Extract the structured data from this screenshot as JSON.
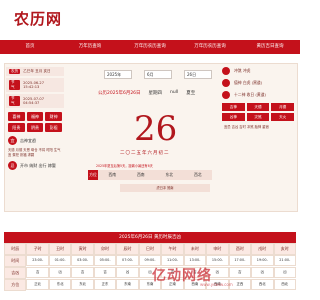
{
  "header": {
    "logo": "农历网"
  },
  "nav": {
    "items": [
      "首页",
      "万年历查询",
      "万年历农历查询",
      "万年历农历查询",
      "黄历吉日查询"
    ]
  },
  "left": {
    "rows": [
      {
        "tag": "农历",
        "val": "乙巳年 丑月 亥日"
      },
      {
        "tag": "节气",
        "val": "2025-06-27 15:42:13"
      },
      {
        "tag": "节气",
        "val": "2025-07-07 04:54:37"
      }
    ],
    "ji_buttons": [
      "喜神",
      "福神",
      "财神",
      "阳贵",
      "阴贵",
      "彭祖"
    ],
    "yi_label": "宜",
    "yi_title": "吉神宜趋",
    "yi_text": "天德 月德 天恩 母仓 不将 时阳 生气 宜 祭祀 祈福 求嗣",
    "ji_label": "忌",
    "ji_text": "开市 纳财 出行 嫁娶"
  },
  "center": {
    "year": "2025年",
    "month": "6月",
    "day": "26日",
    "solar": "公历2025年6月26日",
    "weekday": "星期四",
    "extra": "null",
    "season": "夏至",
    "big_day": "26",
    "lunar": "二〇二五年六月初二",
    "note": "2025年夏至后第5天，距离小暑还有6天",
    "dir_label": "方位",
    "dirs": [
      "西南",
      "西南",
      "东北",
      "西北"
    ],
    "chong": "虎日冲 煞南"
  },
  "right": {
    "rows": [
      {
        "label": "冲煞",
        "val": "冲虎"
      },
      {
        "label": "值神",
        "val": "白虎 (黑道)"
      },
      {
        "label": "十二神",
        "val": "收日 (黄道)"
      }
    ],
    "buttons": [
      "吉神",
      "天德",
      "月德",
      "凶神",
      "灾煞",
      "天火"
    ],
    "bottom": "宜忌 吉凶 吉时 冲煞 胎神 星宿"
  },
  "table": {
    "title": "2025年6月26日 黄历时辰吉凶",
    "headers": [
      "时辰",
      "子时",
      "丑时",
      "寅时",
      "卯时",
      "辰时",
      "巳时",
      "午时",
      "未时",
      "申时",
      "酉时",
      "戌时",
      "亥时"
    ],
    "row1": [
      "时间",
      "23:00-00:59",
      "01:00-02:59",
      "03:00-04:59",
      "05:00-06:59",
      "07:00-08:59",
      "09:00-10:59",
      "11:00-12:59",
      "13:00-14:59",
      "15:00-16:59",
      "17:00-18:59",
      "19:00-20:59",
      "21:00-22:59"
    ],
    "row2": [
      "吉凶",
      "吉",
      "凶",
      "吉",
      "吉",
      "凶",
      "凶",
      "吉",
      "吉",
      "凶",
      "吉",
      "凶",
      "凶"
    ],
    "row3": [
      "方位",
      "正北",
      "东北",
      "东北",
      "正东",
      "东南",
      "东南",
      "正南",
      "西南",
      "西南",
      "正西",
      "西北",
      "西北"
    ]
  },
  "watermark": {
    "text": "亿动网络",
    "sub": "www.ydwlw.com"
  }
}
